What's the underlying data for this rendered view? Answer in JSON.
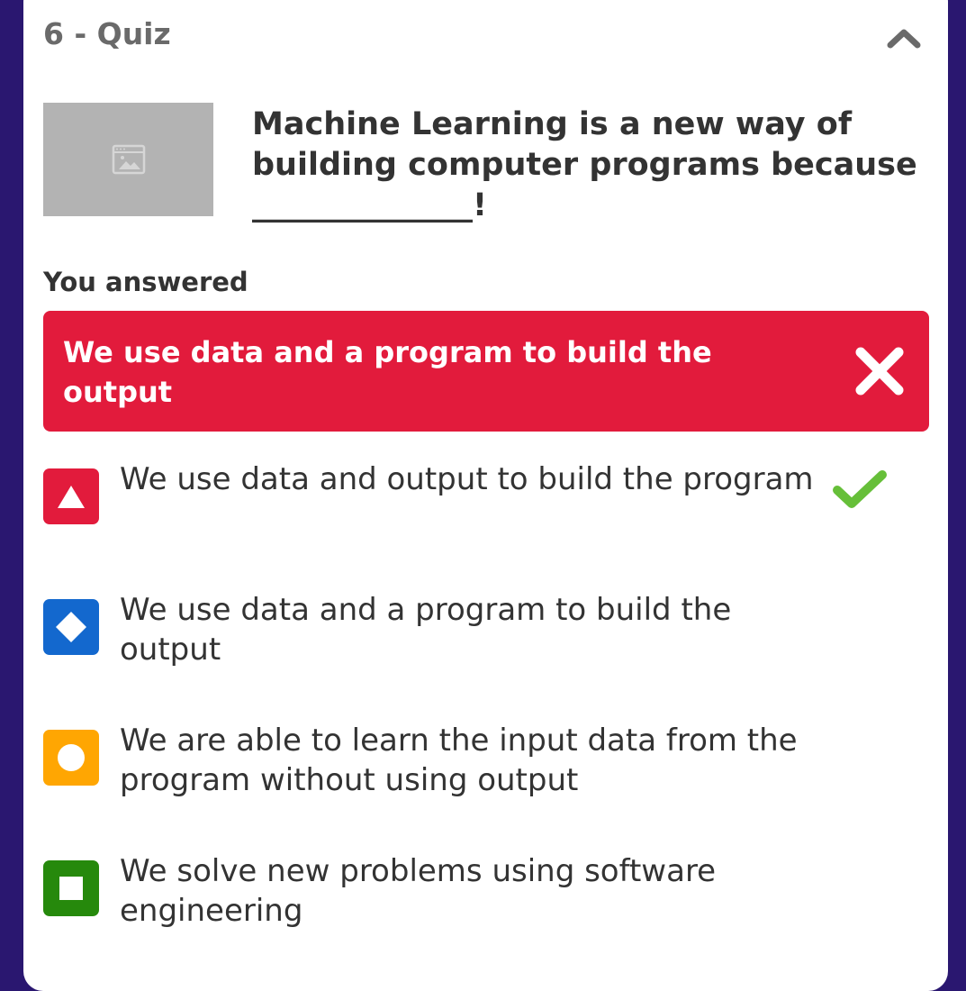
{
  "quiz": {
    "title": "6 - Quiz",
    "question": "Machine Learning is a new way of building computer programs because ______________!"
  },
  "result": {
    "heading": "You answered",
    "selected_answer": "We use data and a program to build the output"
  },
  "options": [
    {
      "shape": "triangle-icon",
      "color": "#e21b3c",
      "label": "We use data and output to build the program",
      "correct": true
    },
    {
      "shape": "diamond-icon",
      "color": "#1368ce",
      "label": "We use data and a program to build the output",
      "correct": false
    },
    {
      "shape": "circle-icon",
      "color": "#ffa602",
      "label": "We are able to learn the input data from the program without using output",
      "correct": false
    },
    {
      "shape": "square-icon",
      "color": "#26890c",
      "label": "We solve new problems using software engineering",
      "correct": false
    }
  ],
  "colors": {
    "background": "#2a1770",
    "wrong": "#e21b3c",
    "correct": "#66bf39"
  }
}
